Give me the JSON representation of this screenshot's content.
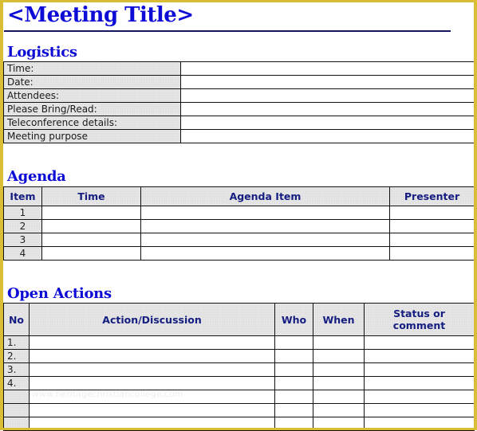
{
  "document": {
    "title": "<Meeting Title>"
  },
  "logistics": {
    "heading": "Logistics",
    "rows": [
      {
        "label": "Time:",
        "value": ""
      },
      {
        "label": "Date:",
        "value": ""
      },
      {
        "label": "Attendees:",
        "value": ""
      },
      {
        "label": "Please Bring/Read:",
        "value": ""
      },
      {
        "label": "Teleconference details:",
        "value": ""
      },
      {
        "label": "Meeting purpose",
        "value": ""
      }
    ]
  },
  "agenda": {
    "heading": "Agenda",
    "columns": [
      "Item",
      "Time",
      "Agenda Item",
      "Presenter"
    ],
    "rows": [
      {
        "item": "1",
        "time": "",
        "agenda_item": "",
        "presenter": ""
      },
      {
        "item": "2",
        "time": "",
        "agenda_item": "",
        "presenter": ""
      },
      {
        "item": "3",
        "time": "",
        "agenda_item": "",
        "presenter": ""
      },
      {
        "item": "4",
        "time": "",
        "agenda_item": "",
        "presenter": ""
      }
    ]
  },
  "open_actions": {
    "heading": "Open Actions",
    "columns": [
      "No",
      "Action/Discussion",
      "Who",
      "When",
      "Status or comment"
    ],
    "rows": [
      {
        "no": "1.",
        "action": "",
        "who": "",
        "when": "",
        "status": ""
      },
      {
        "no": "2.",
        "action": "",
        "who": "",
        "when": "",
        "status": ""
      },
      {
        "no": "3.",
        "action": "",
        "who": "",
        "when": "",
        "status": ""
      },
      {
        "no": "4.",
        "action": "",
        "who": "",
        "when": "",
        "status": ""
      },
      {
        "no": "",
        "action": "",
        "who": "",
        "when": "",
        "status": ""
      },
      {
        "no": "",
        "action": "",
        "who": "",
        "when": "",
        "status": ""
      },
      {
        "no": "",
        "action": "",
        "who": "",
        "when": "",
        "status": ""
      }
    ]
  },
  "watermark": "www.heritagechristiancollege.com",
  "colors": {
    "heading": "#0c0cd6",
    "table_header_text": "#151d80",
    "frame": "#d9bd35",
    "label_fill": "#e6e6e6"
  }
}
